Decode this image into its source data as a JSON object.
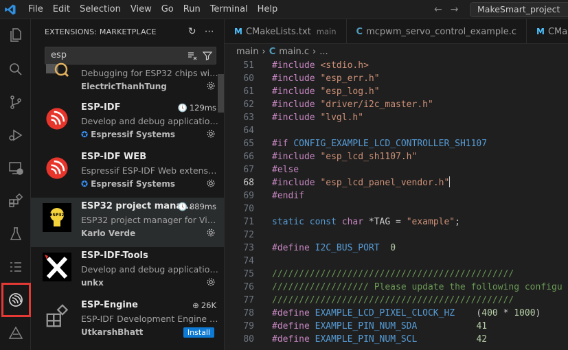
{
  "menu": [
    "File",
    "Edit",
    "Selection",
    "View",
    "Go",
    "Run",
    "Terminal",
    "Help"
  ],
  "command_center": "MakeSmart_project",
  "sidebar": {
    "title": "EXTENSIONS: MARKETPLACE",
    "search_value": "esp",
    "extensions": [
      {
        "name": "",
        "desc": "Debugging for ESP32 chips with...",
        "publisher": "ElectricThanhTung",
        "stat": ""
      },
      {
        "name": "ESP-IDF",
        "desc": "Develop and debug applications...",
        "publisher": "Espressif Systems",
        "stat": "129ms"
      },
      {
        "name": "ESP-IDF WEB",
        "desc": "Espressif ESP-IDF Web extension...",
        "publisher": "Espressif Systems",
        "stat": ""
      },
      {
        "name": "ESP32 project mana...",
        "desc": "ESP32 project manager for Visua...",
        "publisher": "Karlo Verde",
        "stat": "889ms"
      },
      {
        "name": "ESP-IDF-Tools",
        "desc": "Develop and debug applications...",
        "publisher": "unkx",
        "stat": ""
      },
      {
        "name": "ESP-Engine",
        "desc": "ESP-IDF Development Engine for...",
        "publisher": "UtkarshBhatt",
        "stat": "26K",
        "install": "Install"
      }
    ]
  },
  "editor": {
    "tabs": [
      {
        "icon": "M",
        "label": "CMakeLists.txt",
        "desc": "main"
      },
      {
        "icon": "C",
        "label": "mcpwm_servo_control_example.c",
        "desc": ""
      },
      {
        "icon": "M",
        "label": "CMakeLis",
        "desc": ""
      }
    ],
    "breadcrumb": [
      "main",
      "main.c",
      "..."
    ],
    "lines": [
      {
        "n": "51",
        "t": "#include <stdio.h>"
      },
      {
        "n": "60",
        "t": "#include \"esp_err.h\""
      },
      {
        "n": "61",
        "t": "#include \"esp_log.h\""
      },
      {
        "n": "62",
        "t": "#include \"driver/i2c_master.h\""
      },
      {
        "n": "63",
        "t": "#include \"lvgl.h\""
      },
      {
        "n": "64",
        "t": ""
      },
      {
        "n": "65",
        "t": "#if CONFIG_EXAMPLE_LCD_CONTROLLER_SH1107"
      },
      {
        "n": "66",
        "t": "#include \"esp_lcd_sh1107.h\""
      },
      {
        "n": "67",
        "t": "#else"
      },
      {
        "n": "68",
        "t": "#include \"esp_lcd_panel_vendor.h\""
      },
      {
        "n": "69",
        "t": "#endif"
      },
      {
        "n": "70",
        "t": ""
      },
      {
        "n": "71",
        "t": "static const char *TAG = \"example\";"
      },
      {
        "n": "72",
        "t": ""
      },
      {
        "n": "73",
        "t": "#define I2C_BUS_PORT  0"
      },
      {
        "n": "74",
        "t": ""
      },
      {
        "n": "75",
        "t": "/////////////////////////////////////////////"
      },
      {
        "n": "76",
        "t": "////////////////// Please update the following configu"
      },
      {
        "n": "77",
        "t": "/////////////////////////////////////////////"
      },
      {
        "n": "78",
        "t": "#define EXAMPLE_LCD_PIXEL_CLOCK_HZ    (400 * 1000)"
      },
      {
        "n": "79",
        "t": "#define EXAMPLE_PIN_NUM_SDA           41"
      },
      {
        "n": "80",
        "t": "#define EXAMPLE_PIN_NUM_SCL           42"
      }
    ]
  }
}
